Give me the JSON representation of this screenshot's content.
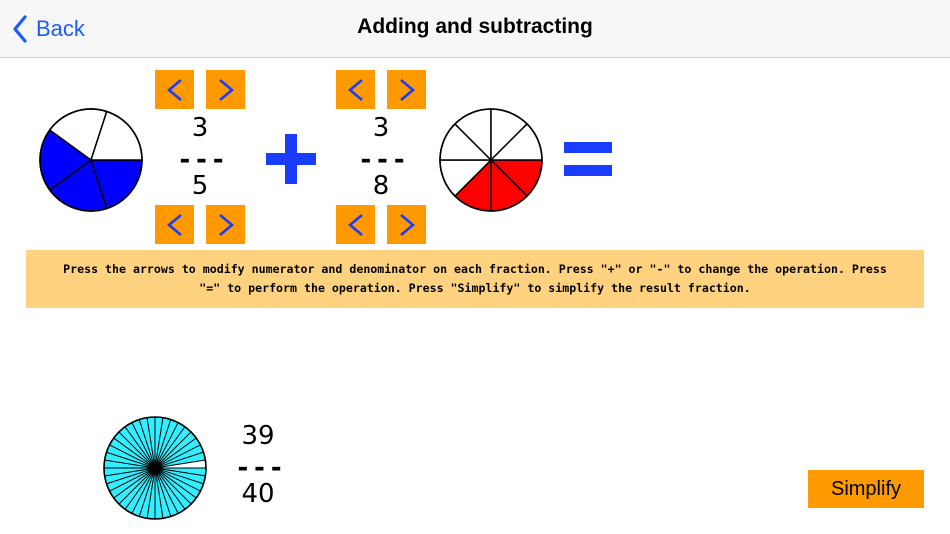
{
  "nav": {
    "back_label": "Back",
    "title": "Adding and subtracting"
  },
  "fraction1": {
    "numerator": "3",
    "separator": "---",
    "denominator": "5",
    "fill_color": "#0000ff",
    "shaded_parts": 3,
    "total_parts": 5
  },
  "fraction2": {
    "numerator": "3",
    "separator": "---",
    "denominator": "8",
    "fill_color": "#ff0000",
    "shaded_parts": 3,
    "total_parts": 8
  },
  "operator": "+",
  "equals": "=",
  "instructions": "Press the arrows to modify numerator and denominator on each fraction. Press \"+\" or \"-\" to change the operation. Press \"=\" to perform the operation. Press \"Simplify\" to simplify the result fraction.",
  "result": {
    "numerator": "39",
    "separator": "---",
    "denominator": "40",
    "fill_color": "#33eeff",
    "shaded_parts": 39,
    "total_parts": 40
  },
  "simplify_label": "Simplify",
  "colors": {
    "accent": "#ff9900",
    "arrow": "#1a3cff",
    "operator": "#1a3cff",
    "nav_tint": "#1a5cff",
    "instructions_bg": "#ffd27f"
  },
  "icons": {
    "back": "chevron-left-icon",
    "decrease": "chevron-left-icon",
    "increase": "chevron-right-icon",
    "operator": "plus-icon",
    "equals": "equals-icon"
  }
}
